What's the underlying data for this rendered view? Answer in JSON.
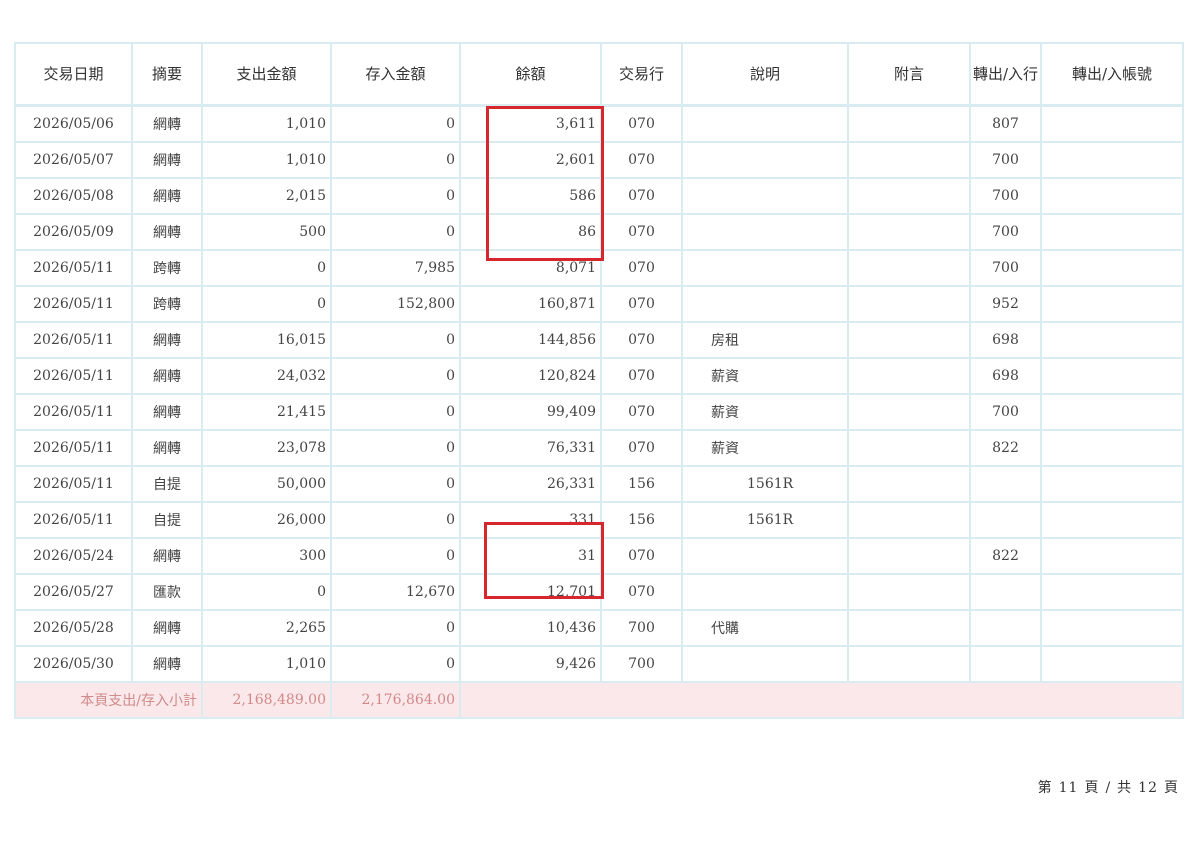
{
  "columns": {
    "date": "交易日期",
    "summary": "摘要",
    "withdrawal": "支出金額",
    "deposit": "存入金額",
    "balance": "餘額",
    "bank": "交易行",
    "description": "說明",
    "memo": "附言",
    "transfer_bank": "轉出/入行",
    "transfer_account": "轉出/入帳號"
  },
  "rows": [
    {
      "date": "2026/05/06",
      "summary": "網轉",
      "withdrawal": "1,010",
      "deposit": "0",
      "balance": "3,611",
      "bank": "070",
      "description": "",
      "memo": "",
      "transfer_bank": "807",
      "transfer_account": ""
    },
    {
      "date": "2026/05/07",
      "summary": "網轉",
      "withdrawal": "1,010",
      "deposit": "0",
      "balance": "2,601",
      "bank": "070",
      "description": "",
      "memo": "",
      "transfer_bank": "700",
      "transfer_account": ""
    },
    {
      "date": "2026/05/08",
      "summary": "網轉",
      "withdrawal": "2,015",
      "deposit": "0",
      "balance": "586",
      "bank": "070",
      "description": "",
      "memo": "",
      "transfer_bank": "700",
      "transfer_account": ""
    },
    {
      "date": "2026/05/09",
      "summary": "網轉",
      "withdrawal": "500",
      "deposit": "0",
      "balance": "86",
      "bank": "070",
      "description": "",
      "memo": "",
      "transfer_bank": "700",
      "transfer_account": ""
    },
    {
      "date": "2026/05/11",
      "summary": "跨轉",
      "withdrawal": "0",
      "deposit": "7,985",
      "balance": "8,071",
      "bank": "070",
      "description": "",
      "memo": "",
      "transfer_bank": "700",
      "transfer_account": ""
    },
    {
      "date": "2026/05/11",
      "summary": "跨轉",
      "withdrawal": "0",
      "deposit": "152,800",
      "balance": "160,871",
      "bank": "070",
      "description": "",
      "memo": "",
      "transfer_bank": "952",
      "transfer_account": ""
    },
    {
      "date": "2026/05/11",
      "summary": "網轉",
      "withdrawal": "16,015",
      "deposit": "0",
      "balance": "144,856",
      "bank": "070",
      "description": "房租",
      "memo": "",
      "transfer_bank": "698",
      "transfer_account": ""
    },
    {
      "date": "2026/05/11",
      "summary": "網轉",
      "withdrawal": "24,032",
      "deposit": "0",
      "balance": "120,824",
      "bank": "070",
      "description": "薪資",
      "memo": "",
      "transfer_bank": "698",
      "transfer_account": ""
    },
    {
      "date": "2026/05/11",
      "summary": "網轉",
      "withdrawal": "21,415",
      "deposit": "0",
      "balance": "99,409",
      "bank": "070",
      "description": "薪資",
      "memo": "",
      "transfer_bank": "700",
      "transfer_account": ""
    },
    {
      "date": "2026/05/11",
      "summary": "網轉",
      "withdrawal": "23,078",
      "deposit": "0",
      "balance": "76,331",
      "bank": "070",
      "description": "薪資",
      "memo": "",
      "transfer_bank": "822",
      "transfer_account": ""
    },
    {
      "date": "2026/05/11",
      "summary": "自提",
      "withdrawal": "50,000",
      "deposit": "0",
      "balance": "26,331",
      "bank": "156",
      "description": "1561R",
      "memo": "",
      "transfer_bank": "",
      "transfer_account": ""
    },
    {
      "date": "2026/05/11",
      "summary": "自提",
      "withdrawal": "26,000",
      "deposit": "0",
      "balance": "331",
      "bank": "156",
      "description": "1561R",
      "memo": "",
      "transfer_bank": "",
      "transfer_account": ""
    },
    {
      "date": "2026/05/24",
      "summary": "網轉",
      "withdrawal": "300",
      "deposit": "0",
      "balance": "31",
      "bank": "070",
      "description": "",
      "memo": "",
      "transfer_bank": "822",
      "transfer_account": ""
    },
    {
      "date": "2026/05/27",
      "summary": "匯款",
      "withdrawal": "0",
      "deposit": "12,670",
      "balance": "12,701",
      "bank": "070",
      "description": "",
      "memo": "",
      "transfer_bank": "",
      "transfer_account": ""
    },
    {
      "date": "2026/05/28",
      "summary": "網轉",
      "withdrawal": "2,265",
      "deposit": "0",
      "balance": "10,436",
      "bank": "700",
      "description": "代購",
      "memo": "",
      "transfer_bank": "",
      "transfer_account": ""
    },
    {
      "date": "2026/05/30",
      "summary": "網轉",
      "withdrawal": "1,010",
      "deposit": "0",
      "balance": "9,426",
      "bank": "700",
      "description": "",
      "memo": "",
      "transfer_bank": "",
      "transfer_account": ""
    }
  ],
  "subtotal": {
    "label": "本頁支出/存入小計",
    "withdrawal": "2,168,489.00",
    "deposit": "2,176,864.00"
  },
  "pager": {
    "prefix": "第",
    "current": "11",
    "page_word": "頁",
    "sep": "/",
    "total_word": "共",
    "total": "12",
    "suffix": "頁"
  },
  "colors": {
    "border": "#d9ecf2",
    "highlight": "#d6262e",
    "subtotal_bg": "#fbe8ea",
    "subtotal_text": "#d08a8a"
  }
}
